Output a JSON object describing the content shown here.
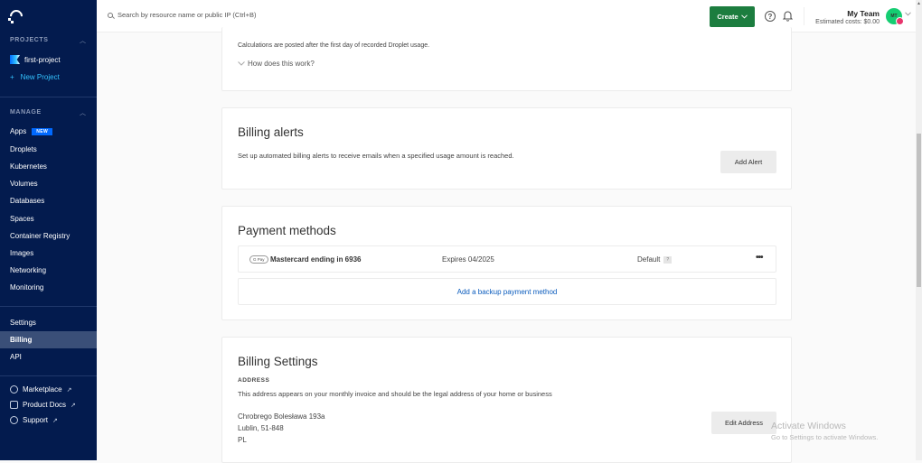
{
  "sidebar": {
    "projects_label": "PROJECTS",
    "project_name": "first-project",
    "new_project": "New Project",
    "manage_label": "MANAGE",
    "new_badge": "NEW",
    "manage_items": [
      "Apps",
      "Droplets",
      "Kubernetes",
      "Volumes",
      "Databases",
      "Spaces",
      "Container Registry",
      "Images",
      "Networking",
      "Monitoring"
    ],
    "account_items": [
      "Settings",
      "Billing",
      "API"
    ],
    "active_item": "Billing",
    "external_links": [
      "Marketplace",
      "Product Docs",
      "Support"
    ],
    "external_arrow": "↗"
  },
  "header": {
    "search_placeholder": "Search by resource name or public IP (Ctrl+B)",
    "create_label": "Create",
    "team_name": "My Team",
    "estimated_costs": "Estimated costs: $0.00",
    "avatar_initials": "MT",
    "help_glyph": "?"
  },
  "usage_card": {
    "note": "Calculations are posted after the first day of recorded Droplet usage.",
    "how_link": "How does this work?"
  },
  "billing_alerts": {
    "title": "Billing alerts",
    "description": "Set up automated billing alerts to receive emails when a specified usage amount is reached.",
    "button": "Add Alert"
  },
  "payment_methods": {
    "title": "Payment methods",
    "wallet_badge": "G Pay",
    "card_name": "Mastercard ending in 6936",
    "expires": "Expires 04/2025",
    "default_label": "Default",
    "default_help": "?",
    "more": "•••",
    "add_backup": "Add a backup payment method"
  },
  "billing_settings": {
    "title": "Billing Settings",
    "address_label": "ADDRESS",
    "address_desc": "This address appears on your monthly invoice and should be the legal address of your home or business",
    "address_lines": [
      "Chrobrego Bolesława 193a",
      "Lublin, 51-848",
      "PL"
    ],
    "edit_button": "Edit Address"
  },
  "watermark": {
    "line1": "Activate Windows",
    "line2": "Go to Settings to activate Windows."
  }
}
